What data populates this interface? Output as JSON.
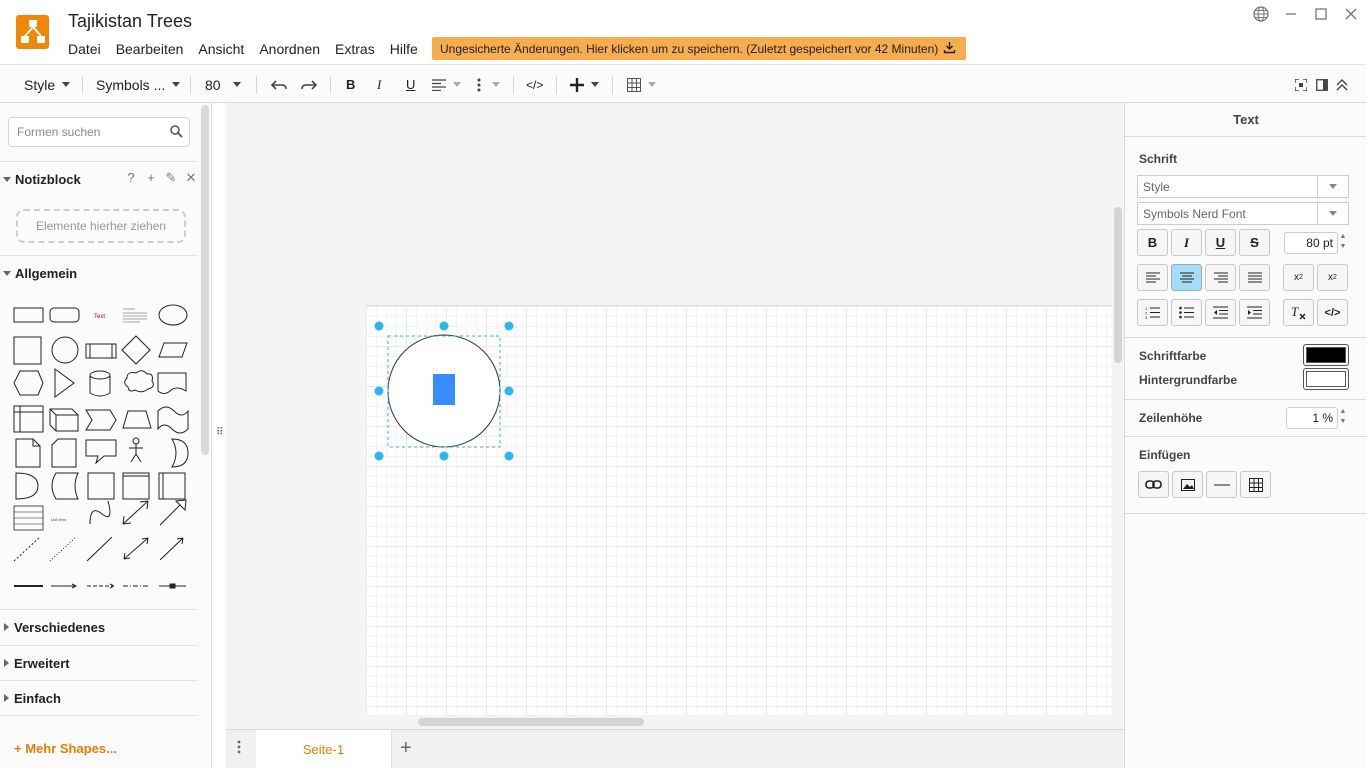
{
  "app": {
    "title": "Tajikistan Trees",
    "menu": [
      "Datei",
      "Bearbeiten",
      "Ansicht",
      "Anordnen",
      "Extras",
      "Hilfe"
    ],
    "save_banner": "Ungesicherte Änderungen. Hier klicken um zu speichern. (Zuletzt gespeichert vor 42 Minuten)",
    "brand_color": "#f08705",
    "banner_color": "#f5ad4e"
  },
  "toolbar": {
    "style_label": "Style",
    "font_label": "Symbols ...",
    "size_label": "80",
    "icons": [
      "undo-icon",
      "redo-icon",
      "bold-icon",
      "italic-icon",
      "underline-icon",
      "align-icon",
      "more-icon",
      "html-icon",
      "insert-icon",
      "table-icon",
      "fullscreen-icon",
      "format-panel-icon",
      "collapse-icon"
    ]
  },
  "sidebar": {
    "search_placeholder": "Formen suchen",
    "sections": {
      "notepad": "Notizblock",
      "general": "Allgemein",
      "misc": "Verschiedenes",
      "advanced": "Erweitert",
      "basic": "Einfach"
    },
    "notepad_tools": [
      "?",
      "+",
      "✎",
      "✕"
    ],
    "dropzone": "Elemente hierher ziehen",
    "more_shapes": "+ Mehr Shapes..."
  },
  "canvas": {
    "selected_shape": "ellipse with blue text cursor",
    "accent": "#29b6f2"
  },
  "pages": {
    "tabs": [
      "Seite-1"
    ],
    "active": "Seite-1"
  },
  "format_panel": {
    "tab": "Text",
    "font_section": "Schrift",
    "style_select": "Style",
    "font_select": "Symbols Nerd Font",
    "font_size": "80 pt",
    "font_color_label": "Schriftfarbe",
    "font_color": "#000000",
    "bg_color_label": "Hintergrundfarbe",
    "bg_color": "#ffffff",
    "line_height_label": "Zeilenhöhe",
    "line_height": "1 %",
    "insert_label": "Einfügen"
  }
}
